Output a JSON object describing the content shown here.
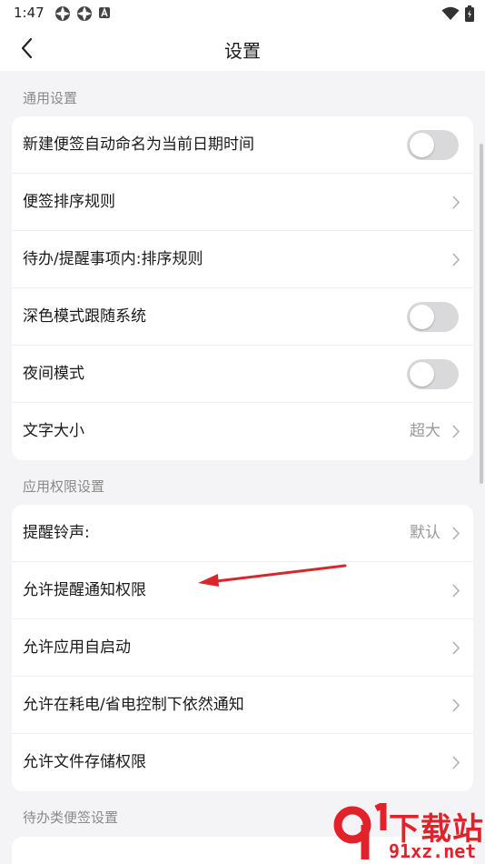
{
  "status_bar": {
    "time": "1:47",
    "left_icons": [
      "gear-icon",
      "gear-icon",
      "a-badge-icon"
    ],
    "right_icons": [
      "wifi-icon",
      "battery-icon"
    ]
  },
  "header": {
    "title": "设置",
    "back_icon": "back-chevron-icon"
  },
  "sections": [
    {
      "label": "通用设置",
      "rows": [
        {
          "label": "新建便签自动命名为当前日期时间",
          "control": "toggle",
          "on": false
        },
        {
          "label": "便签排序规则",
          "control": "chevron"
        },
        {
          "label": "待办/提醒事项内:排序规则",
          "control": "chevron"
        },
        {
          "label": "深色模式跟随系统",
          "control": "toggle",
          "on": false
        },
        {
          "label": "夜间模式",
          "control": "toggle",
          "on": false
        },
        {
          "label": "文字大小",
          "value": "超大",
          "control": "chevron"
        }
      ]
    },
    {
      "label": "应用权限设置",
      "rows": [
        {
          "label": "提醒铃声:",
          "value": "默认",
          "control": "chevron"
        },
        {
          "label": "允许提醒通知权限",
          "control": "chevron"
        },
        {
          "label": "允许应用自启动",
          "control": "chevron"
        },
        {
          "label": "允许在耗电/省电控制下依然通知",
          "control": "chevron"
        },
        {
          "label": "允许文件存储权限",
          "control": "chevron"
        }
      ]
    },
    {
      "label": "待办类便签设置",
      "rows": []
    }
  ],
  "watermark": {
    "text_big": "下载站",
    "text_small": "91xz.net"
  },
  "colors": {
    "background": "#f4f4f6",
    "card": "#ffffff",
    "toggle_off": "#d9d9db",
    "annotation_arrow": "#d9262c",
    "watermark": "#e2222a"
  }
}
